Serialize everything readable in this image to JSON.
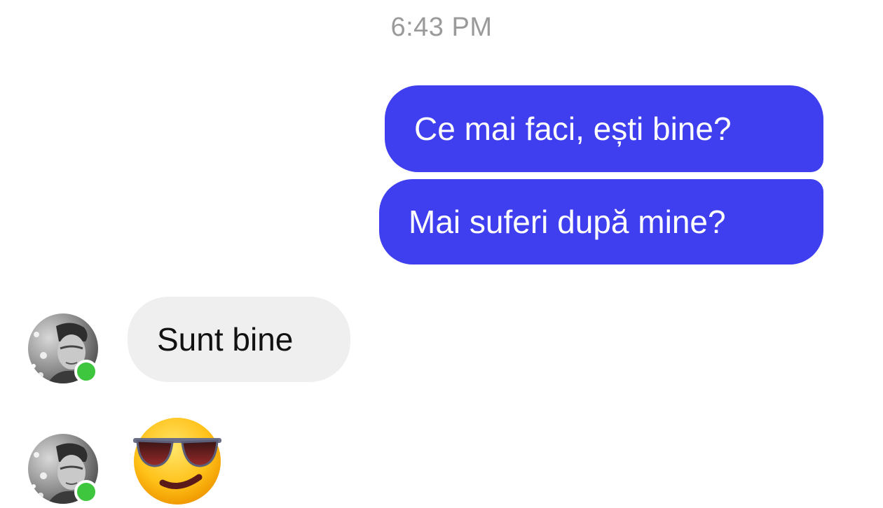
{
  "conversation": {
    "timestamp": "6:43 PM",
    "messages": [
      {
        "sender": "me",
        "text": "Ce mai faci, ești bine?"
      },
      {
        "sender": "me",
        "text": "Mai suferi după mine?"
      },
      {
        "sender": "contact",
        "text": "Sunt bine"
      },
      {
        "sender": "contact",
        "emoji": "smiling-face-with-sunglasses-icon"
      }
    ]
  },
  "colors": {
    "outgoing_bubble": "#3f3ff0",
    "incoming_bubble": "#efefef",
    "timestamp": "#9a9a9a",
    "presence": "#3ec63e"
  }
}
